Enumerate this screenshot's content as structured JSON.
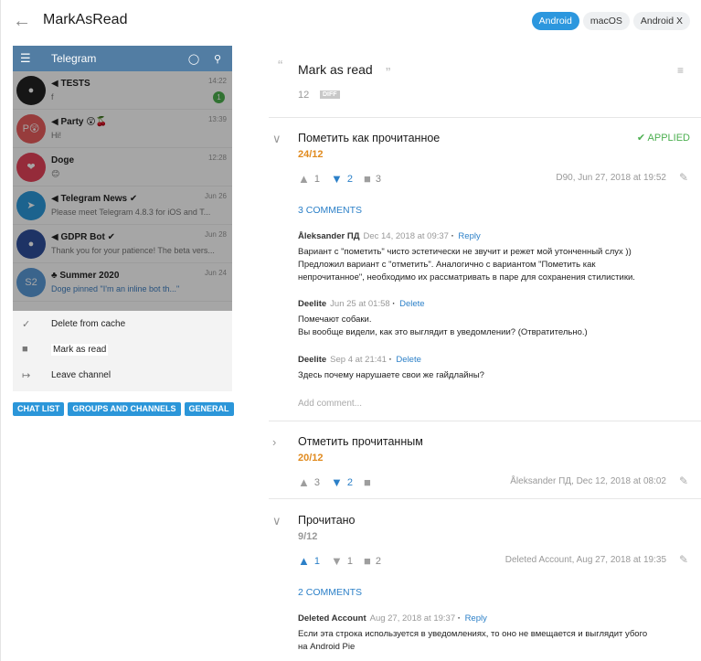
{
  "header": {
    "title": "MarkAsRead",
    "platforms": [
      {
        "label": "Android",
        "active": true
      },
      {
        "label": "macOS",
        "active": false
      },
      {
        "label": "Android X",
        "active": false
      }
    ]
  },
  "screenshot": {
    "app_title": "Telegram",
    "chats": [
      {
        "name": "◀ TESTS",
        "msg": "f",
        "time": "14:22",
        "badge": "1"
      },
      {
        "name": "◀ Party 😲🍒",
        "msg": "Hi!",
        "time": "13:39",
        "avatar_text": "P😲"
      },
      {
        "name": "Doge",
        "msg": "😊",
        "time": "12:28"
      },
      {
        "name": "◀ Telegram News ✔",
        "msg": "Please meet Telegram 4.8.3 for iOS and T...",
        "time": "Jun 26"
      },
      {
        "name": "◀ GDPR Bot ✔",
        "msg": "Thank you for your patience! The beta vers...",
        "time": "Jun 28"
      },
      {
        "name": "♣ Summer 2020",
        "msg": "Doge pinned \"I'm an inline bot th...\"",
        "time": "Jun 24",
        "avatar_text": "S2"
      }
    ],
    "menu": [
      {
        "label": "Delete from cache",
        "icon": "broom-icon"
      },
      {
        "label": "Mark as read",
        "icon": "message-icon"
      },
      {
        "label": "Leave channel",
        "icon": "exit-icon"
      }
    ]
  },
  "tags": [
    "CHAT LIST",
    "GROUPS AND CHANNELS",
    "GENERAL"
  ],
  "key": {
    "title": "Mark as read",
    "count": "12",
    "diff": "DIFF"
  },
  "translations": [
    {
      "text": "Пометить как прочитанное",
      "score": "24/12",
      "score_color": "#e08a1e",
      "applied": "APPLIED",
      "up": "1",
      "down": "2",
      "comments": "3",
      "meta": "D90, Jun 27, 2018 at 19:52",
      "comments_link": "3 COMMENTS",
      "comment_list": [
        {
          "author": "Åleksander ПД",
          "date": "Dec 14, 2018 at 09:37",
          "action": "Reply",
          "text": "Вариант с \"пометить\" чисто эстетически не звучит и режет мой утонченный слух ))\nПредложил вариант с \"отметить\". Аналогично с вариантом \"Пометить как\nнепрочитанное\", необходимо их рассматривать в паре для сохранения стилистики."
        },
        {
          "author": "Deelite",
          "date": "Jun 25 at 01:58",
          "action": "Delete",
          "text": "Помечают собаки.\nВы вообще видели, как это выглядит в уведомлении? (Отвратительно.)"
        },
        {
          "author": "Deelite",
          "date": "Sep 4 at 21:41",
          "action": "Delete",
          "text": "Здесь почему нарушаете свои же гайдлайны?"
        }
      ],
      "add_comment": "Add comment..."
    },
    {
      "text": "Отметить прочитанным",
      "score": "20/12",
      "score_color": "#e08a1e",
      "up": "3",
      "down": "2",
      "meta": "Åleksander ПД, Dec 12, 2018 at 08:02"
    },
    {
      "text": "Прочитано",
      "score": "9/12",
      "score_color": "#999999",
      "up": "1",
      "down": "1",
      "comments": "2",
      "meta": "Deleted Account, Aug 27, 2018 at 19:35",
      "comments_link": "2 COMMENTS",
      "comment_list": [
        {
          "author": "Deleted Account",
          "date": "Aug 27, 2018 at 19:37",
          "action": "Reply",
          "text": "Если эта строка используется в уведомлениях, то оно не вмещается и выглядит убого\nна Android Pie"
        }
      ]
    }
  ]
}
